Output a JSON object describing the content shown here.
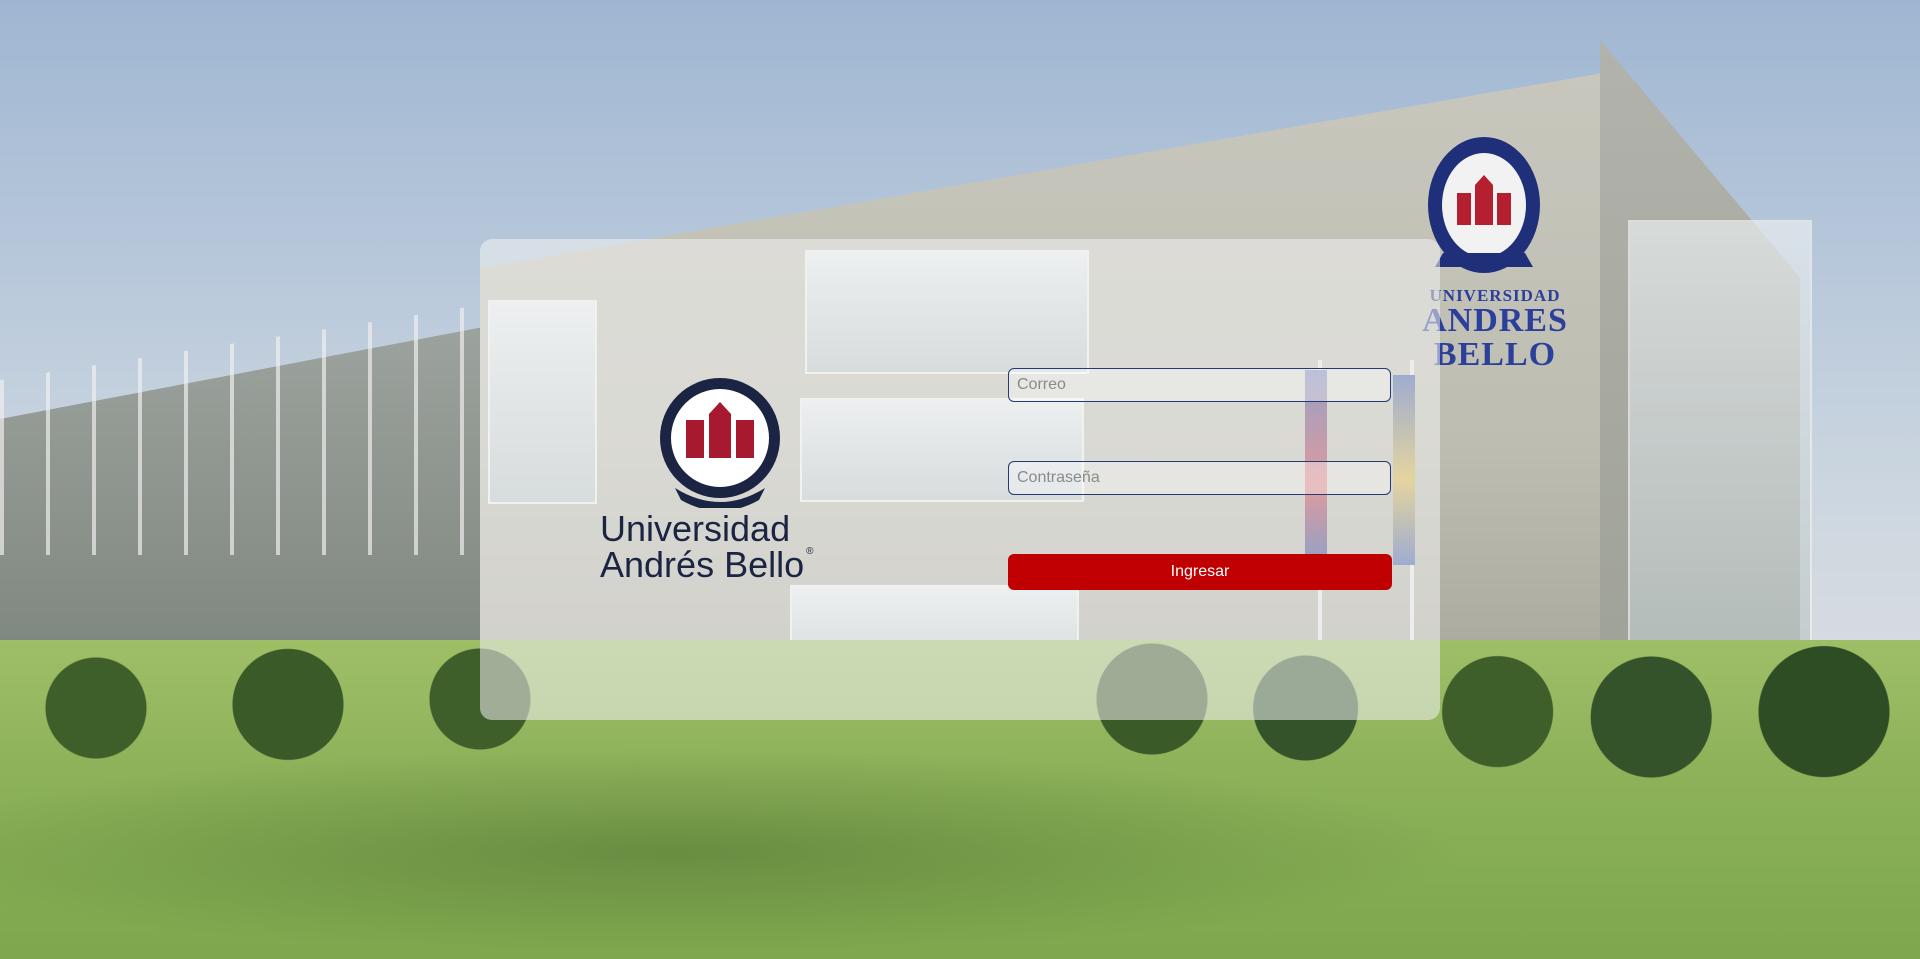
{
  "login": {
    "email_placeholder": "Correo",
    "password_placeholder": "Contraseña",
    "submit_label": "Ingresar"
  },
  "logo": {
    "name_line1": "Universidad",
    "name_line2": "Andrés Bello",
    "registered_mark": "®"
  },
  "background": {
    "wall_sign_line1": "UNIVERSIDAD",
    "wall_sign_line2": "ANDRES BELLO"
  },
  "colors": {
    "brand_navy": "#1b2442",
    "brand_red": "#a6192e",
    "button_red": "#c00000",
    "field_border": "#233a72"
  }
}
